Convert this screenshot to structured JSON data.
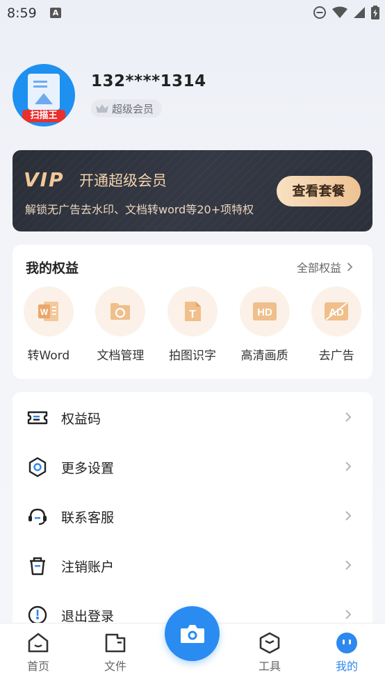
{
  "status_bar": {
    "time": "8:59",
    "a_badge": "A"
  },
  "profile": {
    "phone": "132****1314",
    "member_label": "超级会员",
    "avatar_tag": "扫描王"
  },
  "vip": {
    "logo": "VIP",
    "title": "开通超级会员",
    "desc": "解锁无广告去水印、文档转word等20+项特权",
    "button": "查看套餐"
  },
  "rights": {
    "title": "我的权益",
    "all_label": "全部权益",
    "items": [
      {
        "label": "转Word",
        "icon": "word-icon"
      },
      {
        "label": "文档管理",
        "icon": "folder-sync-icon"
      },
      {
        "label": "拍图识字",
        "icon": "text-recognition-icon"
      },
      {
        "label": "高清画质",
        "icon": "hd-icon"
      },
      {
        "label": "去广告",
        "icon": "no-ad-icon"
      }
    ]
  },
  "menu": {
    "items": [
      {
        "label": "权益码",
        "icon": "ticket-icon"
      },
      {
        "label": "更多设置",
        "icon": "settings-icon"
      },
      {
        "label": "联系客服",
        "icon": "headset-icon"
      },
      {
        "label": "注销账户",
        "icon": "trash-icon"
      },
      {
        "label": "退出登录",
        "icon": "logout-icon"
      }
    ]
  },
  "nav": {
    "items": [
      {
        "label": "首页",
        "icon": "home-icon"
      },
      {
        "label": "文件",
        "icon": "folder-icon"
      },
      {
        "label": "工具",
        "icon": "tools-icon"
      },
      {
        "label": "我的",
        "icon": "profile-icon"
      }
    ],
    "active_index": 3
  },
  "colors": {
    "accent": "#2d88f0",
    "vip_gold": "#f0c89a",
    "rights_bg": "#fbf1e8",
    "rights_icon": "#e9b07a"
  }
}
